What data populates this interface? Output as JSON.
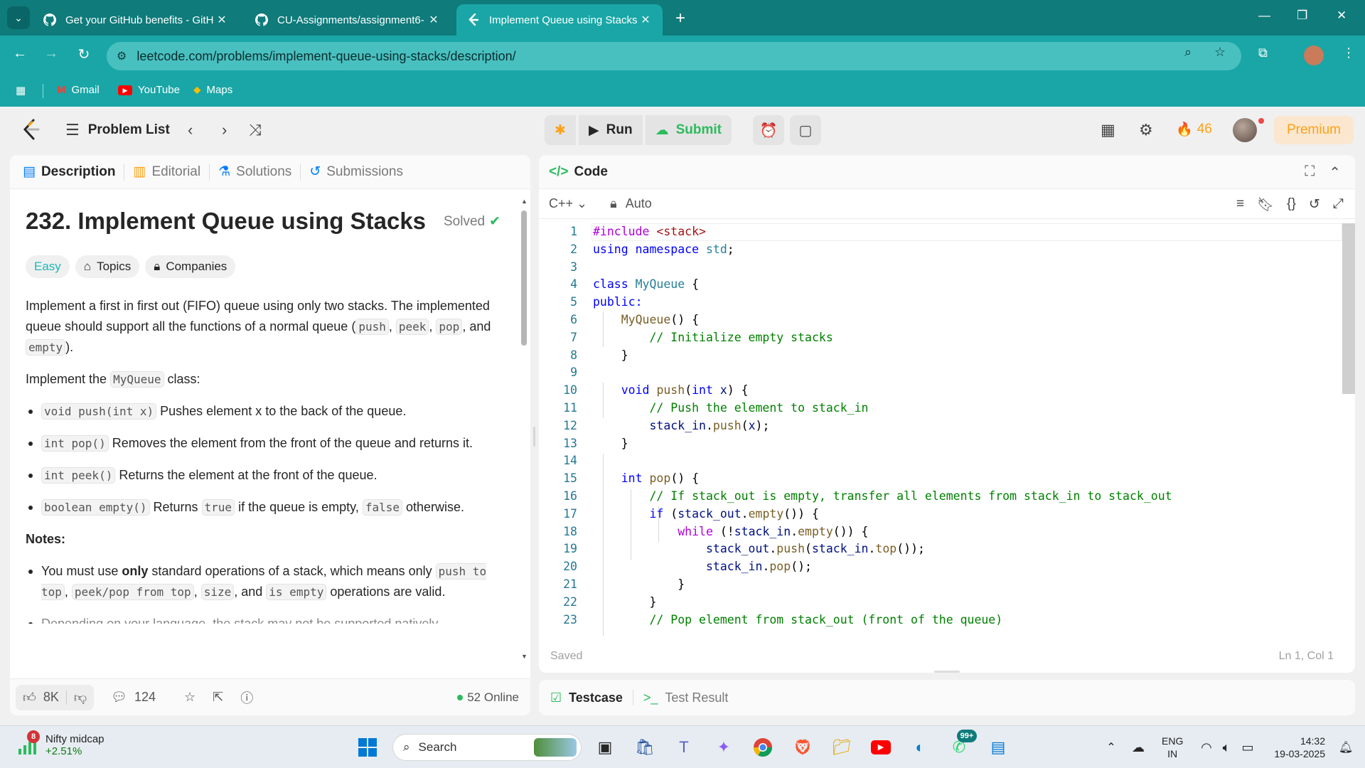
{
  "browser": {
    "tabs": [
      {
        "title": "Get your GitHub benefits - GitH",
        "icon": "github-icon",
        "active": false
      },
      {
        "title": "CU-Assignments/assignment6-",
        "icon": "github-icon",
        "active": false
      },
      {
        "title": "Implement Queue using Stacks",
        "icon": "leetcode-icon",
        "active": true
      }
    ],
    "url": "leetcode.com/problems/implement-queue-using-stacks/description/",
    "bookmarks": [
      "Gmail",
      "YouTube",
      "Maps"
    ],
    "accent": "#1aa6a6"
  },
  "lc_header": {
    "problem_list": "Problem List",
    "run": "Run",
    "submit": "Submit",
    "streak": "46",
    "premium": "Premium"
  },
  "left_panel": {
    "tabs": [
      "Description",
      "Editorial",
      "Solutions",
      "Submissions"
    ],
    "title": "232. Implement Queue using Stacks",
    "solved": "Solved",
    "difficulty": "Easy",
    "chips": [
      "Topics",
      "Companies"
    ],
    "intro": {
      "t1": "Implement a first in first out (FIFO) queue using only two stacks. The implemented queue should support all the functions of a normal queue (",
      "c1": "push",
      "c2": "peek",
      "c3": "pop",
      "t2": ", and ",
      "c4": "empty",
      "t3": ")."
    },
    "implement": {
      "t1": "Implement the ",
      "code": "MyQueue",
      "t2": " class:"
    },
    "methods": [
      {
        "code": "void push(int x)",
        "text": " Pushes element x to the back of the queue."
      },
      {
        "code": "int pop()",
        "text": " Removes the element from the front of the queue and returns it."
      },
      {
        "code": "int peek()",
        "text": " Returns the element at the front of the queue."
      }
    ],
    "empty_method": {
      "code": "boolean empty()",
      "t1": " Returns ",
      "c_true": "true",
      "t2": " if the queue is empty, ",
      "c_false": "false",
      "t3": " otherwise."
    },
    "notes_heading": "Notes:",
    "note1": {
      "t1": "You must use ",
      "bold": "only",
      "t2": " standard operations of a stack, which means only ",
      "c1": "push to top",
      "c2": "peek/pop from top",
      "c3": "size",
      "t3": ", and ",
      "c4": "is empty",
      "t4": " operations are valid."
    },
    "note2_cut": "Depending on your language, the stack may not be supported natively.",
    "footer": {
      "likes": "8K",
      "comments": "124",
      "online": "52 Online"
    }
  },
  "code_panel": {
    "title": "Code",
    "language": "C++",
    "mode": "Auto",
    "status": "Saved",
    "cursor": "Ln 1, Col 1"
  },
  "bottom_panel": {
    "testcase": "Testcase",
    "test_result": "Test Result"
  },
  "taskbar": {
    "ticker_name": "Nifty midcap",
    "ticker_change": "+2.51%",
    "ticker_badge": "8",
    "search": "Search",
    "whatsapp_badge": "99+",
    "lang": "ENG",
    "region": "IN",
    "time": "14:32",
    "date": "19-03-2025"
  }
}
